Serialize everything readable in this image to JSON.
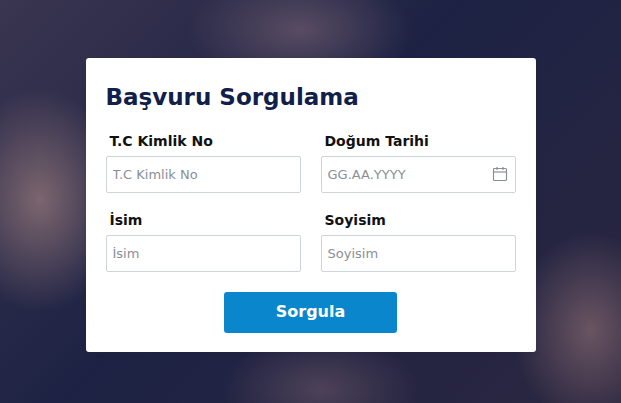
{
  "title": "Başvuru Sorgulama",
  "fields": [
    {
      "label": "T.C Kimlik No",
      "placeholder": "T.C Kimlik No",
      "kind": "text"
    },
    {
      "label": "Doğum Tarihi",
      "placeholder": "GG.AA.YYYY",
      "kind": "date"
    },
    {
      "label": "İsim",
      "placeholder": "İsim",
      "kind": "text"
    },
    {
      "label": "Soyisim",
      "placeholder": "Soyisim",
      "kind": "text"
    }
  ],
  "buttons": [
    "Sorgula"
  ]
}
